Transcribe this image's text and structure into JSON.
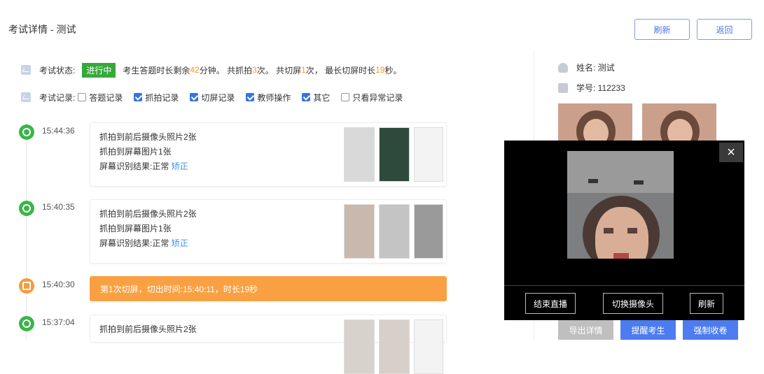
{
  "header": {
    "title": "考试详情 - 测试",
    "refresh_label": "刷新",
    "back_label": "返回"
  },
  "status": {
    "label": "考试状态:",
    "badge": "进行中",
    "t1": "考生答题时长剩余",
    "remaining": "42",
    "t2": "分钟。 共抓拍",
    "captures": "3",
    "t3": "次。 共切屏",
    "switches": "1",
    "t4": "次， 最长切屏时长",
    "max_switch": "19",
    "t5": "秒。"
  },
  "records": {
    "label": "考试记录:",
    "filters": [
      {
        "label": "答题记录",
        "checked": false
      },
      {
        "label": "抓拍记录",
        "checked": true
      },
      {
        "label": "切屏记录",
        "checked": true
      },
      {
        "label": "教师操作",
        "checked": true
      },
      {
        "label": "其它",
        "checked": true
      },
      {
        "label": "只看异常记录",
        "checked": false
      }
    ]
  },
  "timeline": [
    {
      "time": "15:44:36",
      "line1": "抓拍到前后摄像头照片2张",
      "line2": "抓拍到屏幕图片1张",
      "line3": "屏幕识别结果:正常",
      "fix": "矫正"
    },
    {
      "time": "15:40:35",
      "line1": "抓拍到前后摄像头照片2张",
      "line2": "抓拍到屏幕图片1张",
      "line3": "屏幕识别结果:正常",
      "fix": "矫正"
    },
    {
      "time": "15:40:30",
      "alert": "第1次切屏，切出时间:15:40:11，时长19秒"
    },
    {
      "time": "15:37:04",
      "line1": "抓拍到前后摄像头照片2张"
    }
  ],
  "profile": {
    "name": "姓名: 测试",
    "id": "学号: 112233"
  },
  "popup": {
    "end_live": "结束直播",
    "switch_camera": "切换摄像头",
    "refresh": "刷新",
    "close_icon": "×"
  },
  "bottom": {
    "export": "导出详情",
    "remind": "提醒考生",
    "force": "强制收卷"
  },
  "colors": {
    "accent": "#4a74e6",
    "green": "#36a83a",
    "orange": "#f59a23",
    "alert": "#f9a142"
  }
}
